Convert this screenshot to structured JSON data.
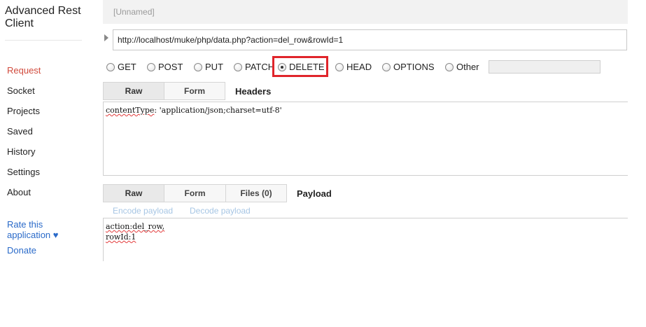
{
  "app": {
    "title_line1": "Advanced Rest",
    "title_line2": "Client"
  },
  "sidebar": {
    "items": [
      {
        "label": "Request",
        "active": true
      },
      {
        "label": "Socket"
      },
      {
        "label": "Projects"
      },
      {
        "label": "Saved"
      },
      {
        "label": "History"
      },
      {
        "label": "Settings"
      },
      {
        "label": "About"
      }
    ],
    "rate_label": "Rate this application ♥",
    "donate_label": "Donate"
  },
  "request": {
    "name": "[Unnamed]",
    "url": "http://localhost/muke/php/data.php?action=del_row&rowId=1",
    "methods": [
      "GET",
      "POST",
      "PUT",
      "PATCH",
      "DELETE",
      "HEAD",
      "OPTIONS",
      "Other"
    ],
    "selected_method": "DELETE",
    "highlight_color": "#e0252b"
  },
  "headers": {
    "tabs": [
      "Raw",
      "Form"
    ],
    "active_tab": "Raw",
    "section_label": "Headers",
    "raw_line_key": "contentType",
    "raw_line_rest": ": 'application/json;charset=utf-8'"
  },
  "payload": {
    "tabs": [
      "Raw",
      "Form",
      "Files (0)"
    ],
    "active_tab": "Raw",
    "section_label": "Payload",
    "encode_label": "Encode payload",
    "decode_label": "Decode payload",
    "line1": "action:del_row,",
    "line2": "rowId:1"
  }
}
